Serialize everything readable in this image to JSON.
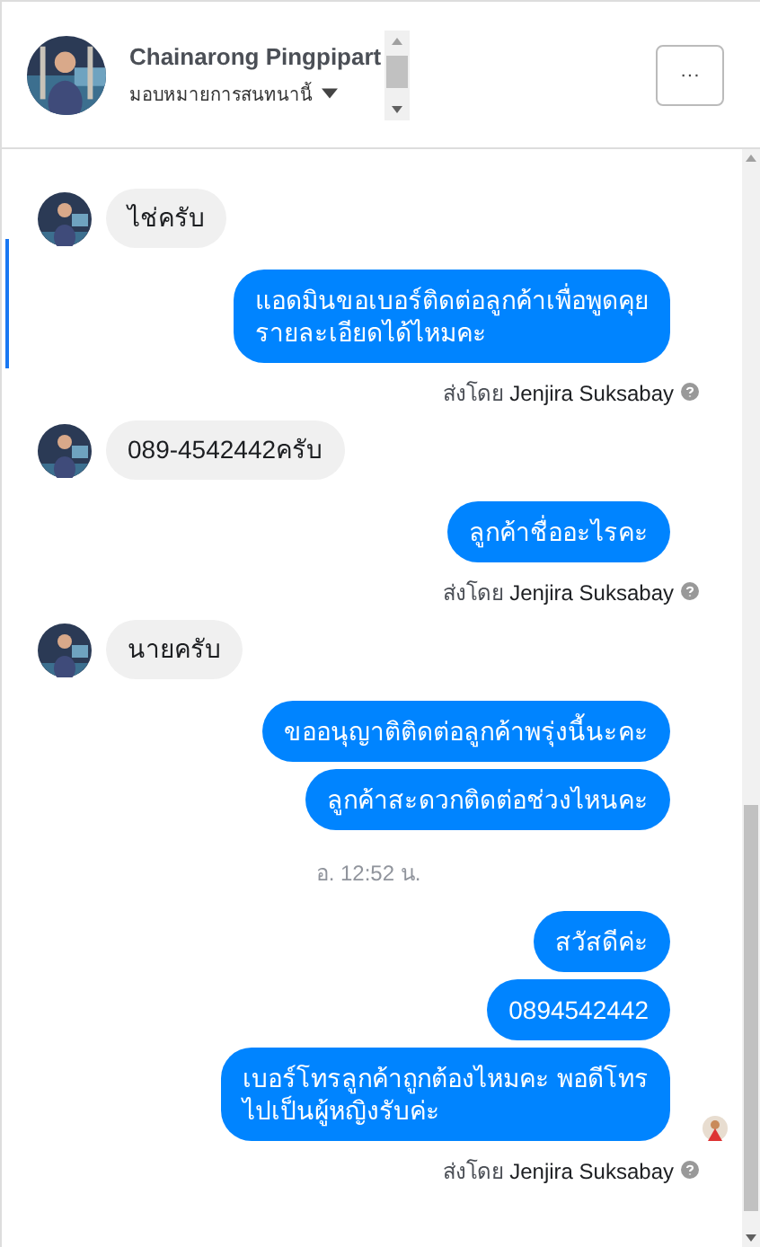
{
  "header": {
    "name": "Chainarong Pingpipart",
    "assign": "มอบหมายการสนทนานี้",
    "more": "···"
  },
  "messages": [
    {
      "kind": "in",
      "text": "ไช่ครับ"
    },
    {
      "kind": "out",
      "texts": [
        "แอดมินขอเบอร์ติดต่อลูกค้าเพื่อพูดคุย\nรายละเอียดได้ไหมคะ"
      ],
      "seen": false
    },
    {
      "kind": "sender",
      "text": "ส่งโดย **Jenjira Suksabay**"
    },
    {
      "kind": "in",
      "text": "089-4542442ครับ"
    },
    {
      "kind": "out",
      "texts": [
        "ลูกค้าชื่ออะไรคะ"
      ],
      "seen": false
    },
    {
      "kind": "sender",
      "text": "ส่งโดย **Jenjira Suksabay**"
    },
    {
      "kind": "in",
      "text": "นายครับ"
    },
    {
      "kind": "out",
      "texts": [
        "ขออนุญาติติดต่อลูกค้าพรุ่งนี้นะคะ",
        "ลูกค้าสะดวกติดต่อช่วงไหนคะ"
      ],
      "seen": false
    },
    {
      "kind": "time",
      "text": "อ. 12:52 น."
    },
    {
      "kind": "out",
      "texts": [
        "สวัสดีค่ะ",
        "0894542442",
        "เบอร์โทรลูกค้าถูกต้องไหมคะ พอดีโทร\nไปเป็นผู้หญิงรับค่ะ"
      ],
      "seen": true
    },
    {
      "kind": "sender",
      "text": "ส่งโดย **Jenjira Suksabay**"
    }
  ]
}
